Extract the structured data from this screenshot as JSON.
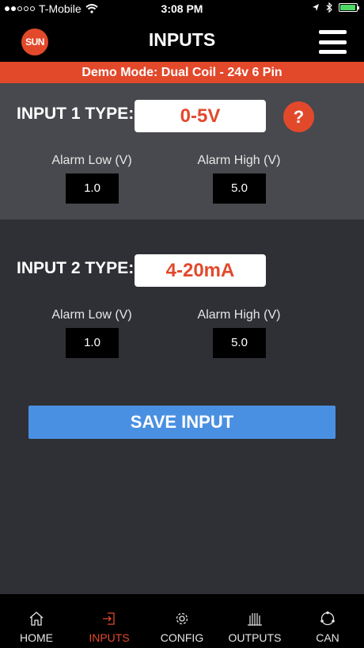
{
  "status_bar": {
    "carrier": "T-Mobile",
    "time": "3:08 PM",
    "signal_bars": 2,
    "battery_level": 0.9
  },
  "header": {
    "logo_text": "SUN",
    "title": "INPUTS"
  },
  "banner": {
    "text": "Demo Mode: Dual Coil - 24v 6 Pin"
  },
  "inputs": [
    {
      "type_label": "INPUT 1 TYPE:",
      "type_value": "0-5V",
      "help": "?",
      "alarm_low_label": "Alarm Low (V)",
      "alarm_low": "1.0",
      "alarm_high_label": "Alarm High (V)",
      "alarm_high": "5.0"
    },
    {
      "type_label": "INPUT 2 TYPE:",
      "type_value": "4-20mA",
      "alarm_low_label": "Alarm Low (V)",
      "alarm_low": "1.0",
      "alarm_high_label": "Alarm High (V)",
      "alarm_high": "5.0"
    }
  ],
  "save_button": "SAVE INPUT",
  "tabs": [
    {
      "label": "HOME",
      "icon": "home-icon"
    },
    {
      "label": "INPUTS",
      "icon": "inputs-icon",
      "active": true
    },
    {
      "label": "CONFIG",
      "icon": "gear-icon"
    },
    {
      "label": "OUTPUTS",
      "icon": "outputs-icon"
    },
    {
      "label": "CAN",
      "icon": "can-network-icon"
    }
  ],
  "colors": {
    "accent": "#e2492b",
    "button": "#4a90e2",
    "section_light": "#48494e",
    "background": "#2f3035"
  }
}
